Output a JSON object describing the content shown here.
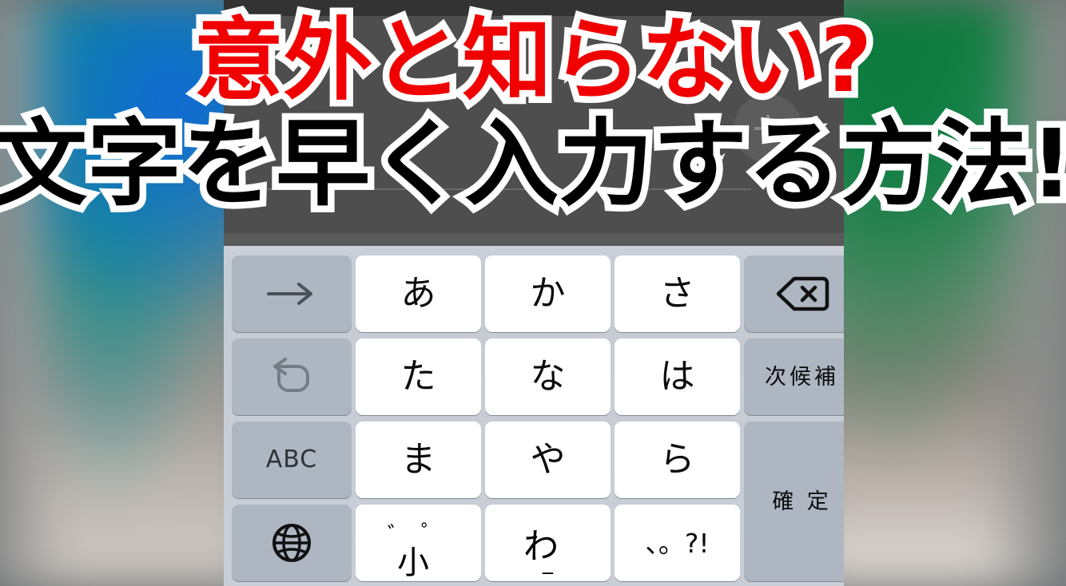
{
  "headline": {
    "line1": "意外と知らない?",
    "line2": "文字を早く入力する方法!",
    "line1_color": "#f00000",
    "line2_color": "#000000",
    "outline_color": "#ffffff"
  },
  "app": {
    "fab_label": "+"
  },
  "keyboard": {
    "background_color": "#c9ced6",
    "white_key_color": "#ffffff",
    "gray_key_color": "#aeb6c2",
    "rows": [
      [
        {
          "name": "cursor-right",
          "label": "→",
          "type": "gray-icon"
        },
        {
          "name": "a-row",
          "label": "あ",
          "type": "white"
        },
        {
          "name": "ka-row",
          "label": "か",
          "type": "white"
        },
        {
          "name": "sa-row",
          "label": "さ",
          "type": "white"
        },
        {
          "name": "delete",
          "label": "",
          "type": "gray-icon"
        }
      ],
      [
        {
          "name": "undo",
          "label": "↺",
          "type": "gray-icon"
        },
        {
          "name": "ta-row",
          "label": "た",
          "type": "white"
        },
        {
          "name": "na-row",
          "label": "な",
          "type": "white"
        },
        {
          "name": "ha-row",
          "label": "は",
          "type": "white"
        },
        {
          "name": "next-candidate",
          "label": "次候補",
          "type": "gray"
        }
      ],
      [
        {
          "name": "abc",
          "label": "ABC",
          "type": "gray"
        },
        {
          "name": "ma-row",
          "label": "ま",
          "type": "white"
        },
        {
          "name": "ya-row",
          "label": "や",
          "type": "white"
        },
        {
          "name": "ra-row",
          "label": "ら",
          "type": "white"
        },
        {
          "name": "confirm",
          "label": "確 定",
          "type": "gray"
        }
      ],
      [
        {
          "name": "globe",
          "label": "",
          "type": "gray-icon"
        },
        {
          "name": "dakuten-small",
          "label": "小",
          "mark_a": "゛",
          "mark_b": "゜",
          "type": "white"
        },
        {
          "name": "wa-row",
          "label": "わ",
          "sub": "_",
          "type": "white"
        },
        {
          "name": "punctuation",
          "label": "、。?!",
          "type": "white"
        }
      ]
    ]
  }
}
